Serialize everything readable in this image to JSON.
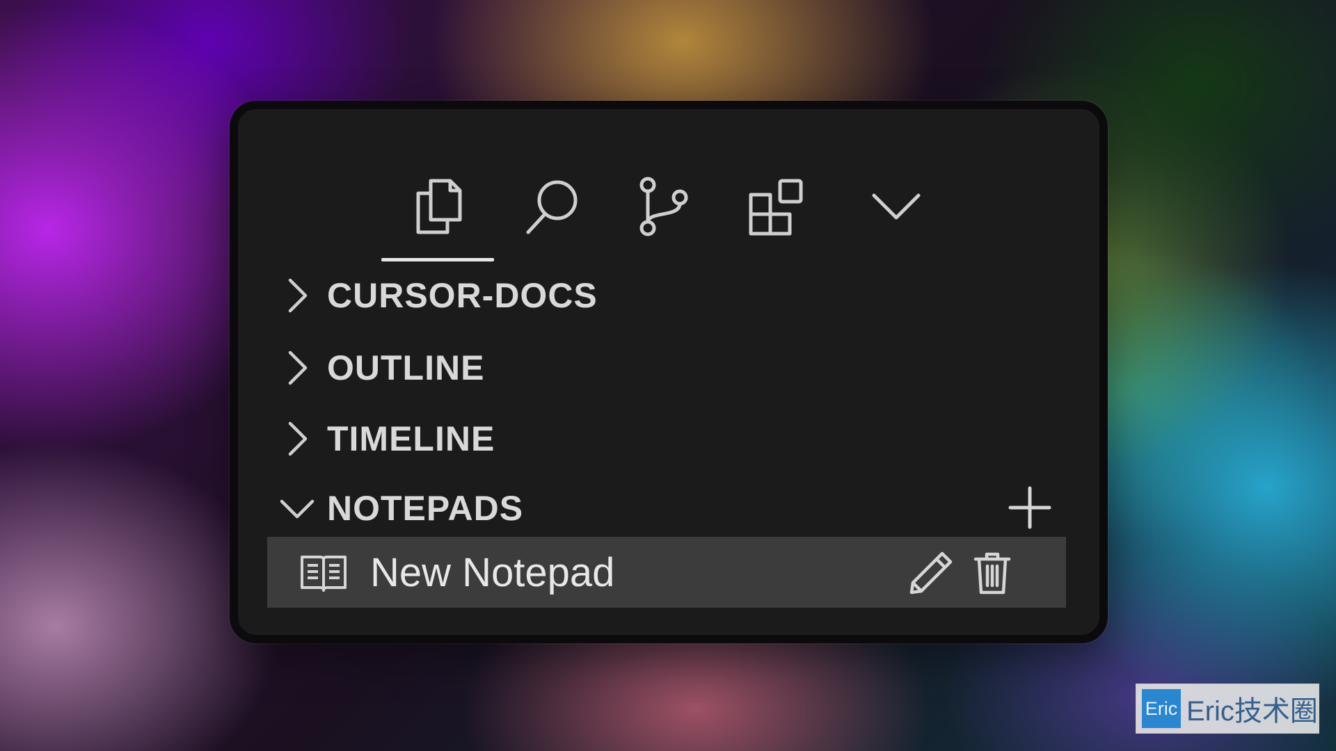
{
  "toolbar": {
    "items": [
      {
        "icon": "explorer-icon",
        "active": true
      },
      {
        "icon": "search-icon"
      },
      {
        "icon": "source-control-icon"
      },
      {
        "icon": "extensions-icon"
      },
      {
        "icon": "chevron-down-icon"
      }
    ]
  },
  "sections": [
    {
      "title": "CURSOR-DOCS",
      "expanded": false
    },
    {
      "title": "OUTLINE",
      "expanded": false
    },
    {
      "title": "TIMELINE",
      "expanded": false
    },
    {
      "title": "NOTEPADS",
      "expanded": true
    }
  ],
  "notepads": {
    "items": [
      {
        "label": "New Notepad"
      }
    ]
  },
  "watermark": {
    "badge": "Eric",
    "text": "Eric技术圈"
  },
  "colors": {
    "panel": "#1b1b1c",
    "row_selected": "#3c3c3d",
    "text": "#d9d9d9",
    "watermark_badge": "#2a86cf"
  }
}
